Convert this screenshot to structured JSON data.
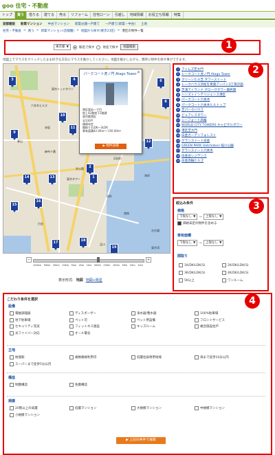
{
  "header": {
    "logo": "goo 住宅・不動産"
  },
  "gnav": [
    "トップ",
    "買う",
    "借りる",
    "建てる",
    "売る",
    "リフォーム",
    "住宅ローン",
    "引越し",
    "地域情報",
    "お役立ち情報",
    "特集"
  ],
  "gnav_active": 1,
  "subnav": {
    "region": "首都圏版",
    "items": [
      "新築マンション",
      "中古マンション",
      "新築分譲一戸建て",
      "一戸建て(新築・中古)",
      "土地"
    ]
  },
  "breadcrumb": [
    "住宅・不動産",
    "買う",
    "新築マンション(首都圏)",
    "地図から探す(東京23区)",
    "港区の物件一覧"
  ],
  "search_bar": {
    "pref": "東京都",
    "radio_station": "駅名で探す",
    "radio_city": "地名で探す",
    "button": "地図検索"
  },
  "badges": [
    "1",
    "2",
    "3",
    "4"
  ],
  "hint": "地図上でマウスをクリックしたまま好きな方向にマウスを動かしてください。地図を動かしながら、簡単に物件を探す事ができます。",
  "map": {
    "pins": [
      "3",
      "4",
      "5",
      "6",
      "7",
      "8",
      "9",
      "10",
      "11",
      "12",
      "13",
      "14",
      "15",
      "16",
      "17",
      "18",
      "19",
      "2",
      "1"
    ],
    "labels": [
      "東京ミッドタウン",
      "六本木ヒルズ",
      "麻布十番",
      "芝公園",
      "東京タワー",
      "田町",
      "品川",
      "お台場",
      "浜松町",
      "新橋",
      "汐留",
      "赤坂",
      "青山",
      "白金",
      "港南",
      "海岸",
      "東京湾"
    ],
    "popup": {
      "title": "パークコート虎ノ門 Atago Tower",
      "desc": "港区愛宕一丁目\n地上42階地下2階建\n東京都港区\n全330戸\n価格未定\n間取り1LDK〜3LDK\n専有面積42.00m²〜150.00m²",
      "button": "物件詳細"
    },
    "zoom_ticks": [
      "100km",
      "50km",
      "20km",
      "10km",
      "5km",
      "2km",
      "1km",
      "500m",
      "250m",
      "100m",
      "50m",
      "25m",
      "10m"
    ],
    "zoom_level": 0.58
  },
  "display": {
    "label": "表示形式:",
    "map": "地図",
    "satellite": "地図+衛星"
  },
  "list": [
    "アイムズ芝大門",
    "レークコート虎ノ門 Atago Tower",
    "クリーンヒル芝 タワースイート",
    "レークハウス浜松を青葉アーバン3丁目計画",
    "芝浦アイランド グローヴタワー最終期",
    "ハンズトインテリジェンス港区",
    "パークコート六本木",
    "パークコート六本木ヒルトップ",
    "芝パークハウス",
    "ピュアレスタワー",
    "シーフォート高輪",
    "WORLD CITY TOWERS キャピタルタワー",
    "港区芝大門",
    "白金ガーデンフォレスト",
    "グランスイート白金",
    "GREEN PARK Hatchobori 桜川公園",
    "グランスイート六本木",
    "白金台レジデンス",
    "白金高輪ヒルズ"
  ],
  "filter": {
    "title": "絞込み条件",
    "price": {
      "label": "価格",
      "min": "下限なし",
      "max": "上限なし",
      "pending": "価格未定の物件を含める",
      "pending_checked": true
    },
    "area": {
      "label": "専有面積",
      "min": "下限なし",
      "max": "上限なし"
    },
    "layout": {
      "label": "間取り",
      "options": [
        "1K/DK/LDK(S)",
        "2K/DK/LDK(S)",
        "3K/DK/LDK(S)",
        "4K/DK/LDK(S)",
        "5K以上",
        "ワンルーム"
      ]
    },
    "sep": "〜"
  },
  "conditions": {
    "title": "こだわり条件を選択",
    "sections": [
      {
        "name": "設備",
        "options": [
          "電磁調理器",
          "ディスポーザー",
          "浄水器/整水器",
          "100%駐車場",
          "地下駐車場",
          "ペット可",
          "ペット用設備",
          "フロントサービス",
          "セキュリティ充実",
          "フィットネス施設",
          "キッズルーム",
          "複合施設住戸",
          "光ファイバー対応",
          "オール電化"
        ]
      },
      {
        "name": "立地",
        "options": [
          "始発駅",
          "複数路線利用可",
          "低層住居専用地域",
          "海まで徒歩10分以内",
          "スーパーまで徒歩5分以内"
        ]
      },
      {
        "name": "構造",
        "options": [
          "制震構造",
          "免震構造"
        ]
      },
      {
        "name": "規模",
        "options": [
          "20階以上の高層",
          "低層マンション",
          "大規模マンション",
          "中規模マンション",
          "小規模マンション"
        ]
      }
    ],
    "button": "上記の条件で検索"
  }
}
